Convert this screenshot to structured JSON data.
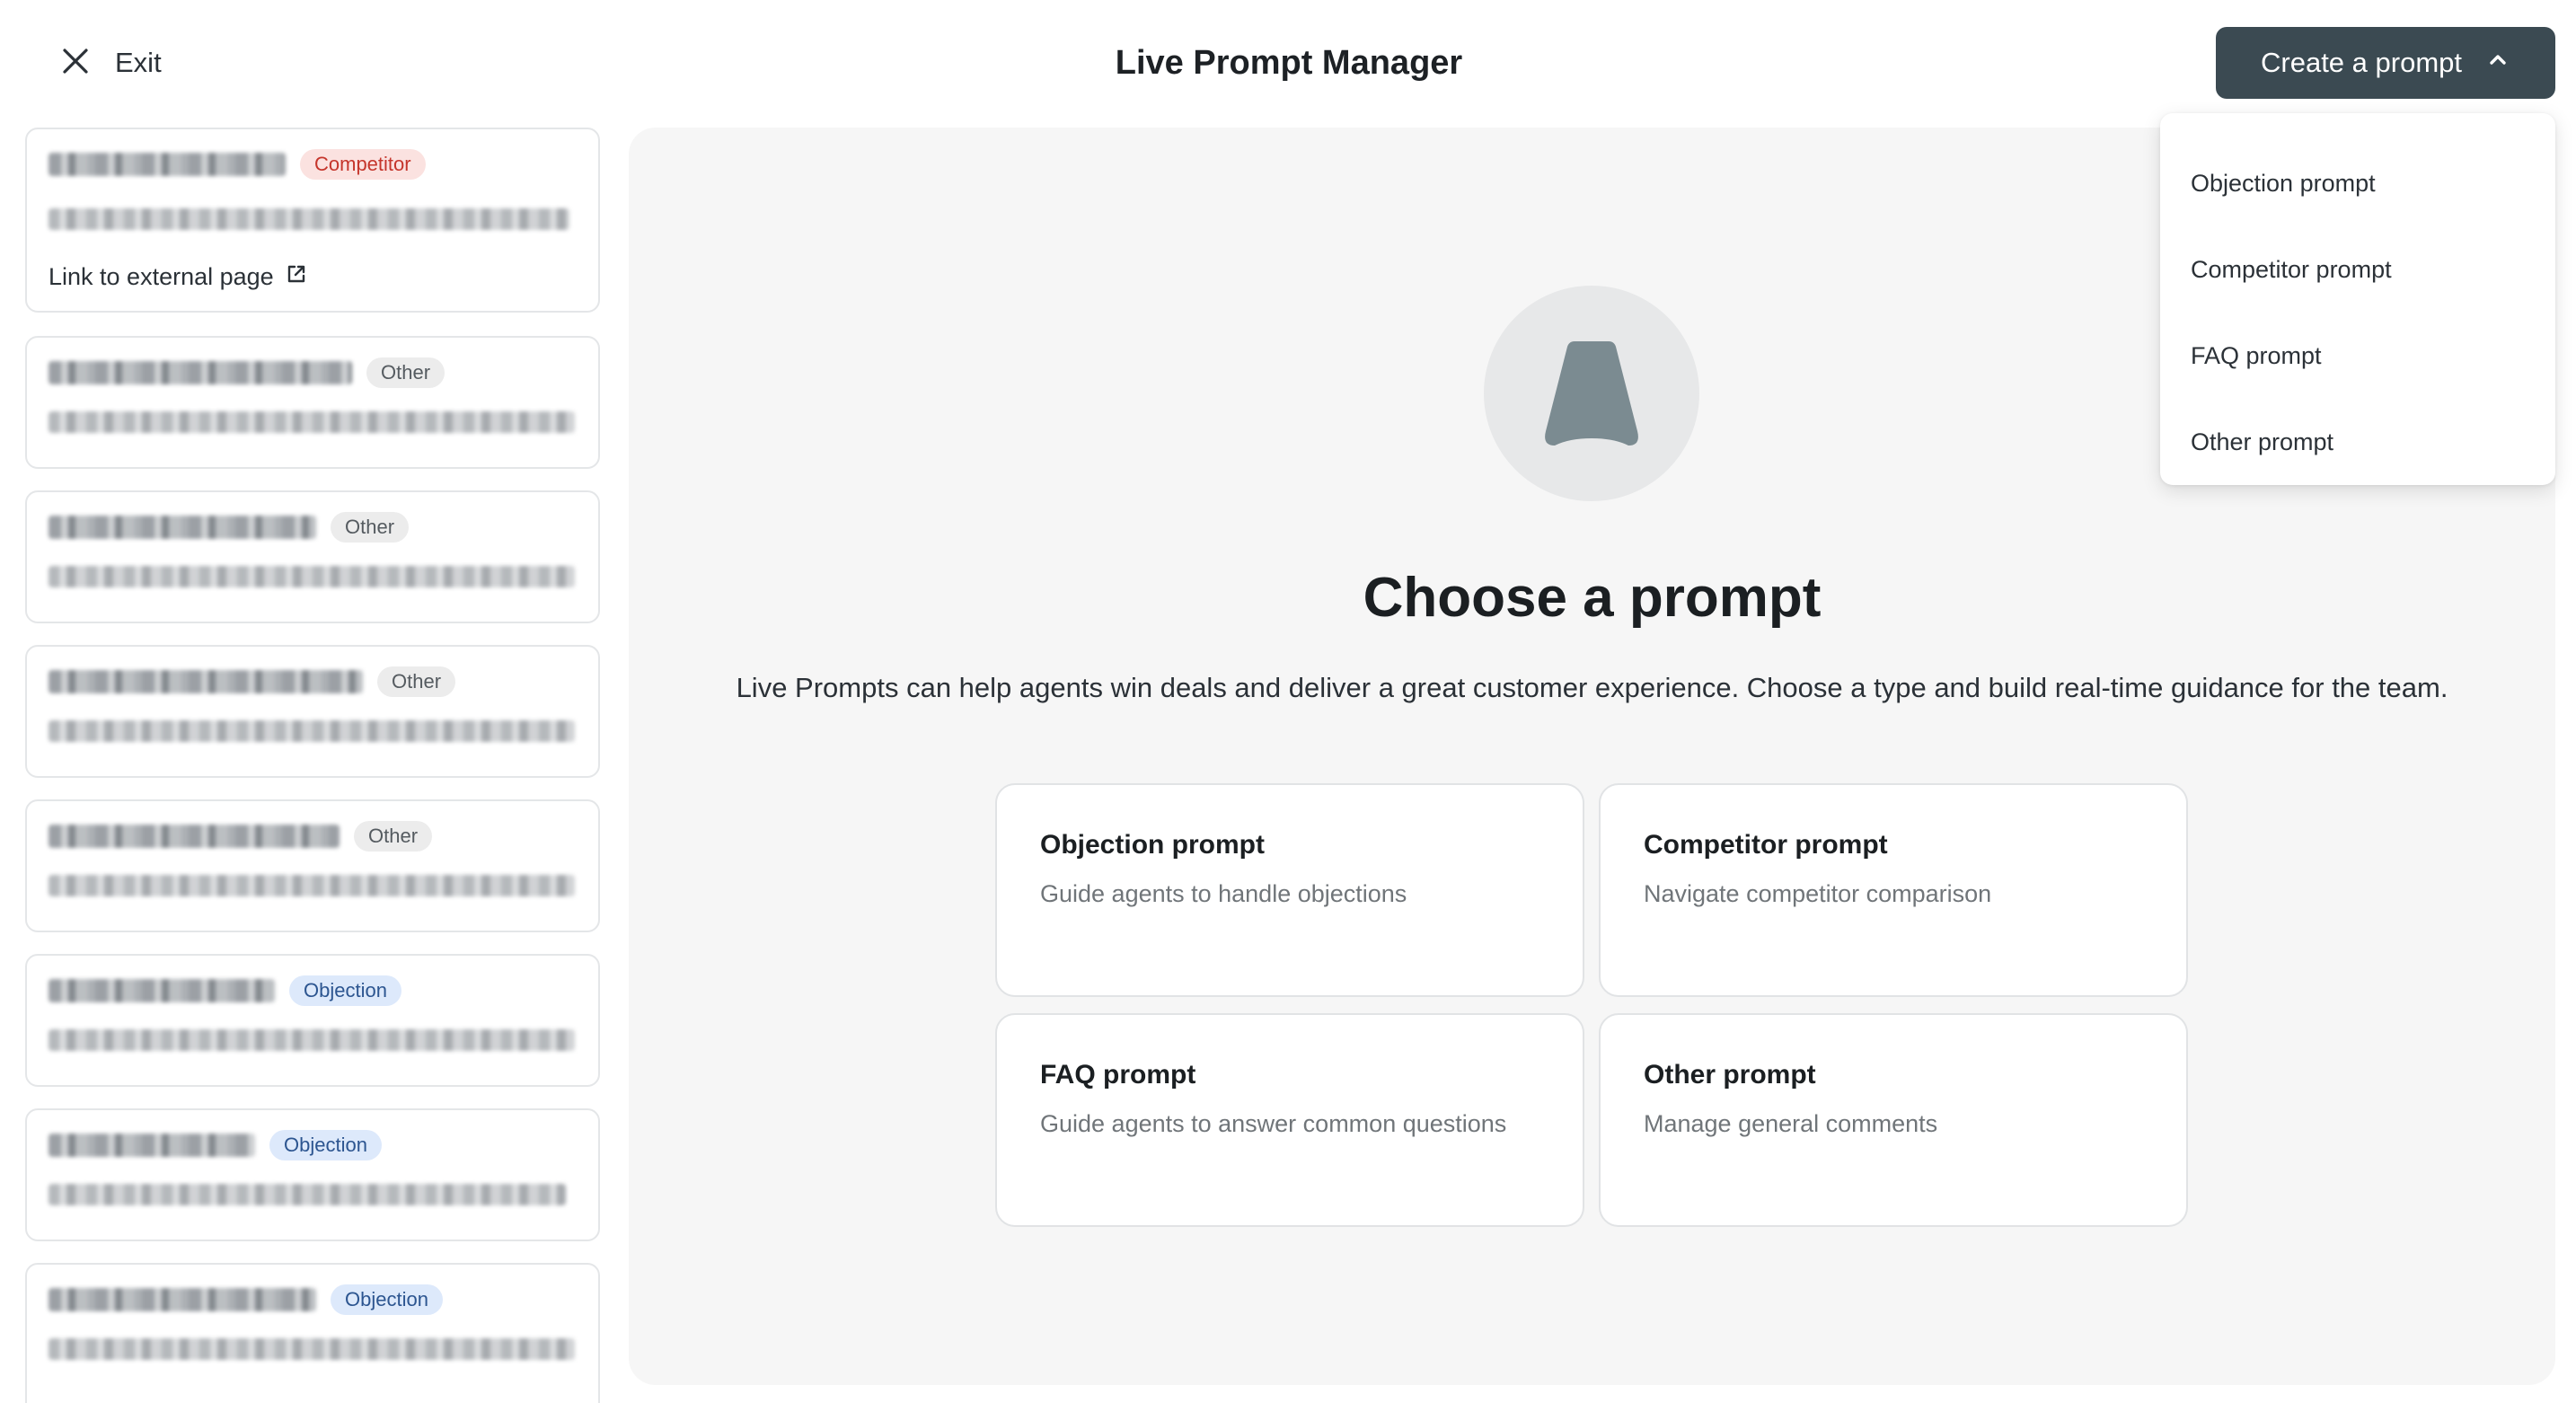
{
  "header": {
    "exit_label": "Exit",
    "title": "Live Prompt Manager",
    "create_button_label": "Create a prompt"
  },
  "dropdown": {
    "items": [
      "Objection prompt",
      "Competitor prompt",
      "FAQ prompt",
      "Other prompt"
    ]
  },
  "prompt_list": [
    {
      "badge": "Competitor",
      "link": "Link to external page"
    },
    {
      "badge": "Other"
    },
    {
      "badge": "Other"
    },
    {
      "badge": "Other"
    },
    {
      "badge": "Other"
    },
    {
      "badge": "Objection"
    },
    {
      "badge": "Objection"
    },
    {
      "badge": "Objection"
    }
  ],
  "main": {
    "title": "Choose a prompt",
    "description": "Live Prompts can help agents win deals and deliver a great customer experience. Choose a type and build real-time guidance for the team.",
    "options": [
      {
        "title": "Objection prompt",
        "description": "Guide agents to handle objections"
      },
      {
        "title": "Competitor prompt",
        "description": "Navigate competitor comparison"
      },
      {
        "title": "FAQ prompt",
        "description": "Guide agents to answer common questions"
      },
      {
        "title": "Other prompt",
        "description": "Manage general comments"
      }
    ]
  },
  "colors": {
    "primary_button": "#3b4a52",
    "competitor_badge": "#fbe2e0",
    "objection_badge": "#dde9fb",
    "other_badge": "#ececec"
  }
}
